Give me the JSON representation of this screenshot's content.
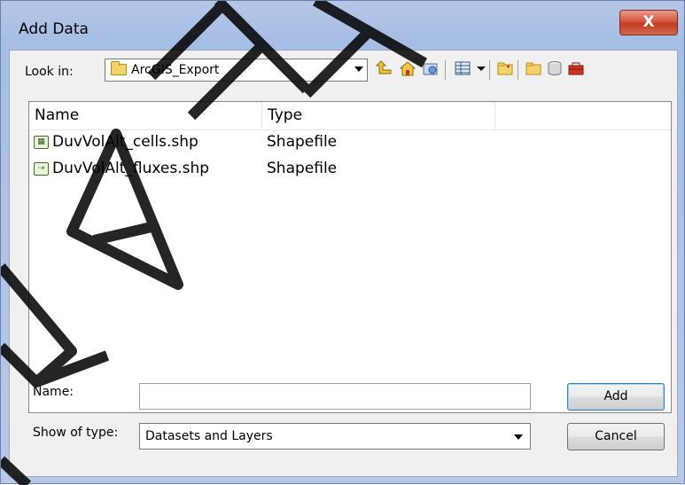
{
  "window": {
    "title": "Add Data",
    "close_label": "X"
  },
  "lookin": {
    "label": "Look in:",
    "value": "ArcGIS_Export"
  },
  "toolbar": {
    "icons": [
      "up-one-level-icon",
      "home-icon",
      "connect-folder-icon",
      "view-menu-icon",
      "view-dropdown-icon",
      "new-folder-icon",
      "folder-icon",
      "database-icon",
      "toolbox-icon"
    ]
  },
  "filelist": {
    "columns": [
      "Name",
      "Type"
    ],
    "rows": [
      {
        "name": "DuvVolAlt_cells.shp",
        "type": "Shapefile"
      },
      {
        "name": "DuvVolAlt_fluxes.shp",
        "type": "Shapefile"
      }
    ]
  },
  "form": {
    "name_label": "Name:",
    "name_value": "",
    "type_label": "Show of type:",
    "type_value": "Datasets and Layers"
  },
  "buttons": {
    "add": "Add",
    "cancel": "Cancel"
  },
  "watermark": "DRAFT"
}
